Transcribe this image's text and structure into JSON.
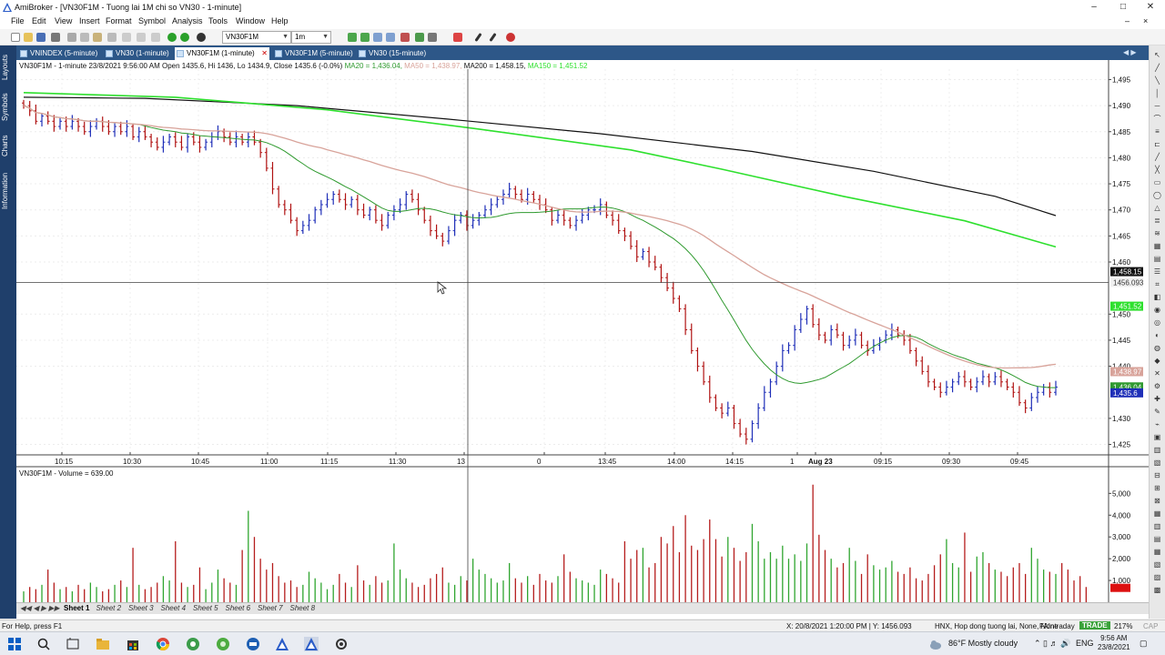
{
  "window": {
    "title": "AmiBroker - [VN30F1M - Tuong lai 1M chi so VN30 - 1-minute]"
  },
  "menu": [
    "File",
    "Edit",
    "View",
    "Insert",
    "Format",
    "Symbol",
    "Analysis",
    "Tools",
    "Window",
    "Help"
  ],
  "toolbar": {
    "symbol": "VN30F1M",
    "interval": "1m"
  },
  "left_panel": [
    "Layouts",
    "Symbols",
    "Charts",
    "Information"
  ],
  "tabs": [
    {
      "label": "VNINDEX (5-minute)",
      "active": false
    },
    {
      "label": "VN30 (1-minute)",
      "active": false
    },
    {
      "label": "VN30F1M (1-minute)",
      "active": true
    },
    {
      "label": "VN30F1M (5-minute)",
      "active": false
    },
    {
      "label": "VN30 (15-minute)",
      "active": false
    }
  ],
  "price_pane": {
    "header_prefix": "VN30F1M - 1-minute 23/8/2021 9:56:00 AM Open 1435.6, Hi 1436, Lo 1434.9, Close 1435.6 (-0.0%)",
    "ma20": "MA20 = 1,436.04,",
    "ma50": "MA50 = 1,438.97,",
    "ma200": "MA200 = 1,458.15,",
    "ma150": "MA150 = 1,451.52",
    "y_ticks": [
      "1,495",
      "1,490",
      "1,485",
      "1,480",
      "1,475",
      "1,470",
      "1,465",
      "1,460",
      "1,450",
      "1,445",
      "1,440",
      "1,430",
      "1,425"
    ],
    "x_ticks": [
      "10:15",
      "10:30",
      "10:45",
      "11:00",
      "11:15",
      "11:30",
      "13",
      "0",
      "13:45",
      "14:00",
      "14:15",
      "1",
      "Aug 23",
      "09:15",
      "09:30",
      "09:45"
    ],
    "tags": {
      "ma200": "1,458.15",
      "crosshair": "1456.093",
      "ma150": "1,451.52",
      "ma50": "1,438.97",
      "ma20": "1,436.04",
      "close": "1,435.6"
    }
  },
  "volume_pane": {
    "header": "VN30F1M - Volume = 639.00",
    "y_ticks": [
      "5,000",
      "4,000",
      "3,000",
      "2,000",
      "1,000"
    ]
  },
  "sheets": [
    "Sheet 1",
    "Sheet 2",
    "Sheet 3",
    "Sheet 4",
    "Sheet 5",
    "Sheet 6",
    "Sheet 7",
    "Sheet 8"
  ],
  "status": {
    "help": "For Help, press F1",
    "cursor": "X: 20/8/2021 1:20:00 PM | Y: 1456.093",
    "info": "HNX, Hop dong tuong lai, None, None",
    "feed": "FAIntraday",
    "mode": "TRADE",
    "zoom": "217%",
    "cap": "CAP"
  },
  "taskbar": {
    "weather": "86°F  Mostly cloudy",
    "lang": "ENG",
    "time": "9:56 AM",
    "date": "23/8/2021"
  },
  "colors": {
    "up_bar": "#1f2fb8",
    "down_bar": "#b01212",
    "ma20": "#2f9a2f",
    "ma50": "#d8a39a",
    "ma150": "#2ee02e",
    "ma200": "#111111",
    "vol_up": "#2fa52f",
    "vol_down": "#b51c1c",
    "tab_bar": "#2d5788",
    "left_panel": "#1f3f6b"
  },
  "chart_data": {
    "type": "ohlc",
    "price_min": 1423,
    "price_max": 1497,
    "close_series": [
      1490,
      1489,
      1487,
      1488,
      1487,
      1486,
      1487,
      1486,
      1487,
      1486,
      1485,
      1486,
      1487,
      1486,
      1485,
      1486,
      1485,
      1486,
      1484,
      1485,
      1484,
      1483,
      1482,
      1483,
      1484,
      1483,
      1482,
      1484,
      1483,
      1482,
      1483,
      1484,
      1485,
      1484,
      1483,
      1484,
      1483,
      1484,
      1483,
      1481,
      1478,
      1474,
      1471,
      1470,
      1468,
      1466,
      1467,
      1468,
      1470,
      1471,
      1472,
      1473,
      1472,
      1471,
      1472,
      1470,
      1469,
      1470,
      1468,
      1467,
      1469,
      1470,
      1471,
      1473,
      1472,
      1470,
      1468,
      1466,
      1465,
      1464,
      1466,
      1468,
      1469,
      1467,
      1468,
      1469,
      1470,
      1471,
      1472,
      1473,
      1474,
      1473,
      1472,
      1473,
      1472,
      1471,
      1470,
      1468,
      1469,
      1468,
      1467,
      1468,
      1469,
      1470,
      1470,
      1471,
      1469,
      1468,
      1466,
      1465,
      1463,
      1461,
      1462,
      1460,
      1459,
      1457,
      1455,
      1453,
      1451,
      1447,
      1443,
      1440,
      1437,
      1434,
      1432,
      1431,
      1432,
      1429,
      1427,
      1426,
      1429,
      1432,
      1435,
      1437,
      1440,
      1443,
      1444,
      1447,
      1449,
      1451,
      1448,
      1446,
      1445,
      1447,
      1446,
      1444,
      1445,
      1446,
      1444,
      1443,
      1444,
      1445,
      1446,
      1447,
      1446,
      1445,
      1443,
      1441,
      1439,
      1437,
      1436,
      1435,
      1436,
      1437,
      1438,
      1437,
      1436,
      1437,
      1438,
      1437,
      1438,
      1437,
      1436,
      1435,
      1433,
      1432,
      1434,
      1435,
      1436,
      1435,
      1436
    ],
    "volume_series": [
      500,
      700,
      600,
      800,
      1500,
      900,
      600,
      700,
      500,
      800,
      600,
      900,
      700,
      500,
      600,
      800,
      1000,
      700,
      2500,
      800,
      600,
      700,
      900,
      1200,
      1000,
      2800,
      900,
      700,
      800,
      1600,
      600,
      900,
      1500,
      1100,
      900,
      800,
      2400,
      4200,
      3000,
      2000,
      1500,
      1800,
      1200,
      900,
      1000,
      700,
      800,
      1400,
      1100,
      900,
      600,
      800,
      1300,
      900,
      700,
      1700,
      1000,
      800,
      1200,
      900,
      1000,
      2700,
      1500,
      1100,
      900,
      700,
      800,
      1100,
      1300,
      1600,
      900,
      800,
      1200,
      1000,
      2000,
      1500,
      1300,
      1100,
      900,
      1000,
      1800,
      1100,
      900,
      1200,
      800,
      1300,
      1000,
      900,
      1200,
      2200,
      1400,
      1100,
      1000,
      900,
      800,
      1500,
      1300,
      1100,
      900,
      2800,
      2000,
      2400,
      2500,
      1600,
      1800,
      3000,
      2700,
      3500,
      2300,
      4000,
      2600,
      2400,
      2900,
      3800,
      2900,
      2100,
      3000,
      2500,
      1900,
      2300,
      3600,
      2800,
      2000,
      2300,
      2000,
      2600,
      2000,
      2200,
      1900,
      2700,
      5400,
      3100,
      2400,
      2000,
      1600,
      1800,
      2500,
      1900,
      1300,
      2200,
      1700,
      1500,
      1600,
      1900,
      1400,
      1300,
      1600,
      1100,
      1000,
      1300,
      1700,
      2200,
      2900,
      1800,
      1600,
      3200,
      1400,
      2100,
      2300,
      1800,
      1500,
      1400,
      1200,
      1600,
      1800,
      1300,
      2500,
      2000,
      1500,
      1400,
      1300,
      1800,
      1500,
      1000,
      1200,
      700
    ]
  }
}
